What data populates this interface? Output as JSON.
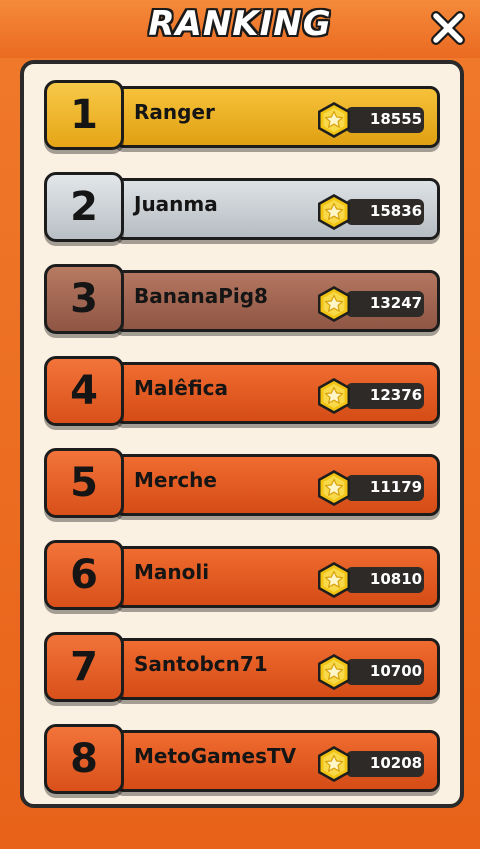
{
  "header": {
    "title": "RANKING"
  },
  "ranking": [
    {
      "rank": "1",
      "name": "Ranger",
      "score": "18555",
      "tier": "gold"
    },
    {
      "rank": "2",
      "name": "Juanma",
      "score": "15836",
      "tier": "silver"
    },
    {
      "rank": "3",
      "name": "BananaPig8",
      "score": "13247",
      "tier": "bronze"
    },
    {
      "rank": "4",
      "name": "Malêfica",
      "score": "12376",
      "tier": "orange"
    },
    {
      "rank": "5",
      "name": "Merche",
      "score": "11179",
      "tier": "orange"
    },
    {
      "rank": "6",
      "name": "Manoli",
      "score": "10810",
      "tier": "orange"
    },
    {
      "rank": "7",
      "name": "Santobcn71",
      "score": "10700",
      "tier": "orange"
    },
    {
      "rank": "8",
      "name": "MetoGamesTV",
      "score": "10208",
      "tier": "orange"
    }
  ],
  "colors": {
    "background": "#e8621a",
    "panel": "#fbf1e2",
    "gold": "#f0b41e",
    "silver": "#c8ced2",
    "bronze": "#a86a52",
    "orange": "#e85e20",
    "coin": "#f2c414"
  },
  "icons": {
    "close": "close-icon",
    "coin": "star-coin-icon"
  }
}
